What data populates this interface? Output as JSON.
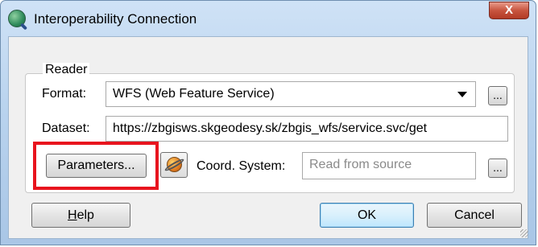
{
  "window": {
    "title": "Interoperability Connection",
    "close_label": "X"
  },
  "reader": {
    "group_title": "Reader",
    "format_label": "Format:",
    "format_value": "WFS (Web Feature Service)",
    "dataset_label": "Dataset:",
    "dataset_value": "https://zbgisws.skgeodesy.sk/zbgis_wfs/service.svc/get",
    "parameters_button": "Parameters...",
    "coord_system_label": "Coord. System:",
    "coord_system_placeholder": "Read from source",
    "browse_label": "...",
    "highlight_color": "#e8141e"
  },
  "buttons": {
    "help_prefix": "",
    "help_underlined": "H",
    "help_rest": "elp",
    "ok": "OK",
    "cancel": "Cancel"
  }
}
